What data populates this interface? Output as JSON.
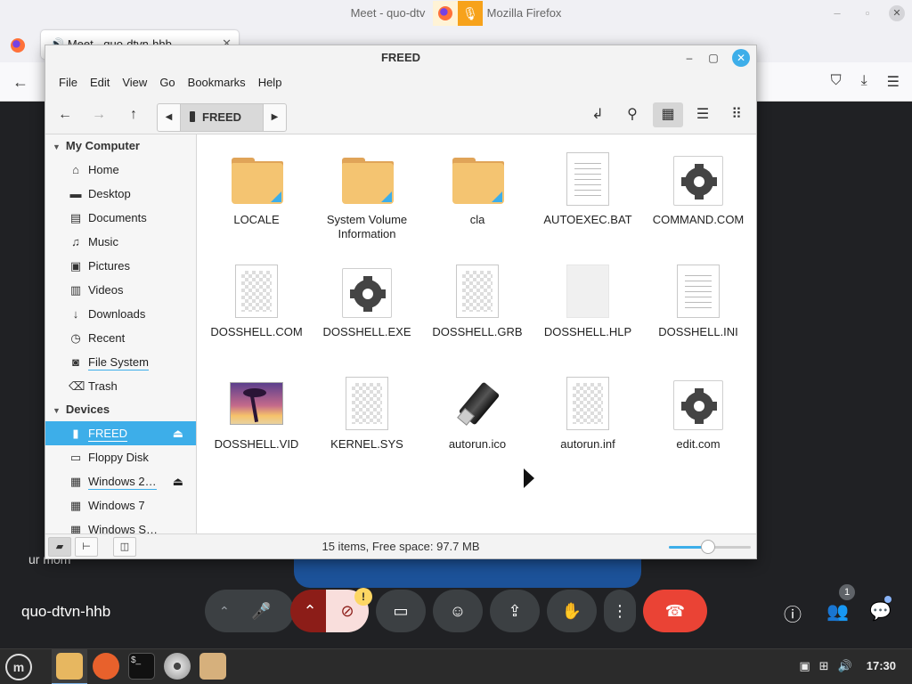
{
  "browser": {
    "window_title_left": "Meet - quo-dtv",
    "window_title_right": "Mozilla Firefox",
    "tab_title": "Meet - quo-dtvn-hhb",
    "tab_close": "✕",
    "back_icon": "←",
    "nav_icons": [
      "pocket-icon",
      "download-icon",
      "menu-icon"
    ]
  },
  "meet": {
    "caption_text": "ur mom",
    "meeting_name": "quo-dtvn-hhb",
    "warning_badge": "!",
    "people_count": "1"
  },
  "file_manager": {
    "title": "FREED",
    "menu": [
      "File",
      "Edit",
      "View",
      "Go",
      "Bookmarks",
      "Help"
    ],
    "breadcrumb": "FREED",
    "sidebar": {
      "sections": [
        {
          "title": "My Computer",
          "items": [
            {
              "label": "Home",
              "icon": "home-icon"
            },
            {
              "label": "Desktop",
              "icon": "desktop-icon"
            },
            {
              "label": "Documents",
              "icon": "documents-icon"
            },
            {
              "label": "Music",
              "icon": "music-icon"
            },
            {
              "label": "Pictures",
              "icon": "pictures-icon"
            },
            {
              "label": "Videos",
              "icon": "videos-icon"
            },
            {
              "label": "Downloads",
              "icon": "downloads-icon"
            },
            {
              "label": "Recent",
              "icon": "recent-icon"
            },
            {
              "label": "File System",
              "icon": "filesystem-icon"
            },
            {
              "label": "Trash",
              "icon": "trash-icon"
            }
          ]
        },
        {
          "title": "Devices",
          "items": [
            {
              "label": "FREED",
              "icon": "usb-drive-icon",
              "active": true,
              "eject": true
            },
            {
              "label": "Floppy Disk",
              "icon": "floppy-icon"
            },
            {
              "label": "Windows 2…",
              "icon": "drive-icon",
              "eject": true
            },
            {
              "label": "Windows 7",
              "icon": "drive-icon"
            },
            {
              "label": "Windows S…",
              "icon": "drive-icon"
            }
          ]
        }
      ]
    },
    "files": [
      {
        "name": "LOCALE",
        "type": "folder"
      },
      {
        "name": "System Volume Information",
        "type": "folder"
      },
      {
        "name": "cla",
        "type": "folder"
      },
      {
        "name": "AUTOEXEC.BAT",
        "type": "text"
      },
      {
        "name": "COMMAND.COM",
        "type": "executable"
      },
      {
        "name": "DOSSHELL.COM",
        "type": "binary"
      },
      {
        "name": "DOSSHELL.EXE",
        "type": "executable"
      },
      {
        "name": "DOSSHELL.GRB",
        "type": "binary"
      },
      {
        "name": "DOSSHELL.HLP",
        "type": "blank"
      },
      {
        "name": "DOSSHELL.INI",
        "type": "text"
      },
      {
        "name": "DOSSHELL.VID",
        "type": "image"
      },
      {
        "name": "KERNEL.SYS",
        "type": "binary"
      },
      {
        "name": "autorun.ico",
        "type": "usb-image"
      },
      {
        "name": "autorun.inf",
        "type": "binary"
      },
      {
        "name": "edit.com",
        "type": "executable"
      }
    ],
    "status_text": "15 items, Free space: 97.7 MB",
    "zoom_level": 0.48
  },
  "taskbar": {
    "clock": "17:30",
    "apps": [
      "file-manager-icon",
      "firefox-icon",
      "terminal-icon",
      "disc-icon",
      "archive-icon"
    ]
  },
  "colors": {
    "accent": "#3daee9",
    "meet_background": "#202124",
    "end_call": "#ea4335"
  }
}
